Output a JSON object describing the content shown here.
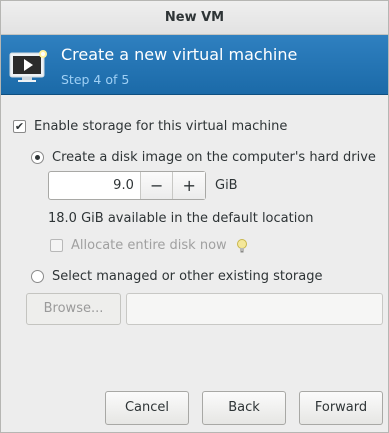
{
  "window": {
    "title": "New VM"
  },
  "header": {
    "title": "Create a new virtual machine",
    "step": "Step 4 of 5"
  },
  "storage": {
    "enable_label": "Enable storage for this virtual machine",
    "enable_checked": true,
    "create_label": "Create a disk image on the computer's hard drive",
    "create_selected": true,
    "size_value": "9.0",
    "decrement": "−",
    "increment": "+",
    "unit": "GiB",
    "available_text": "18.0 GiB available in the default location",
    "allocate_label": "Allocate entire disk now",
    "allocate_checked": false,
    "existing_label": "Select managed or other existing storage",
    "existing_selected": false,
    "browse_label": "Browse...",
    "path_value": ""
  },
  "footer": {
    "cancel": "Cancel",
    "back": "Back",
    "forward": "Forward"
  },
  "colors": {
    "header_bg": "#1f6fb0",
    "header_subtitle": "#9fd0f5"
  }
}
